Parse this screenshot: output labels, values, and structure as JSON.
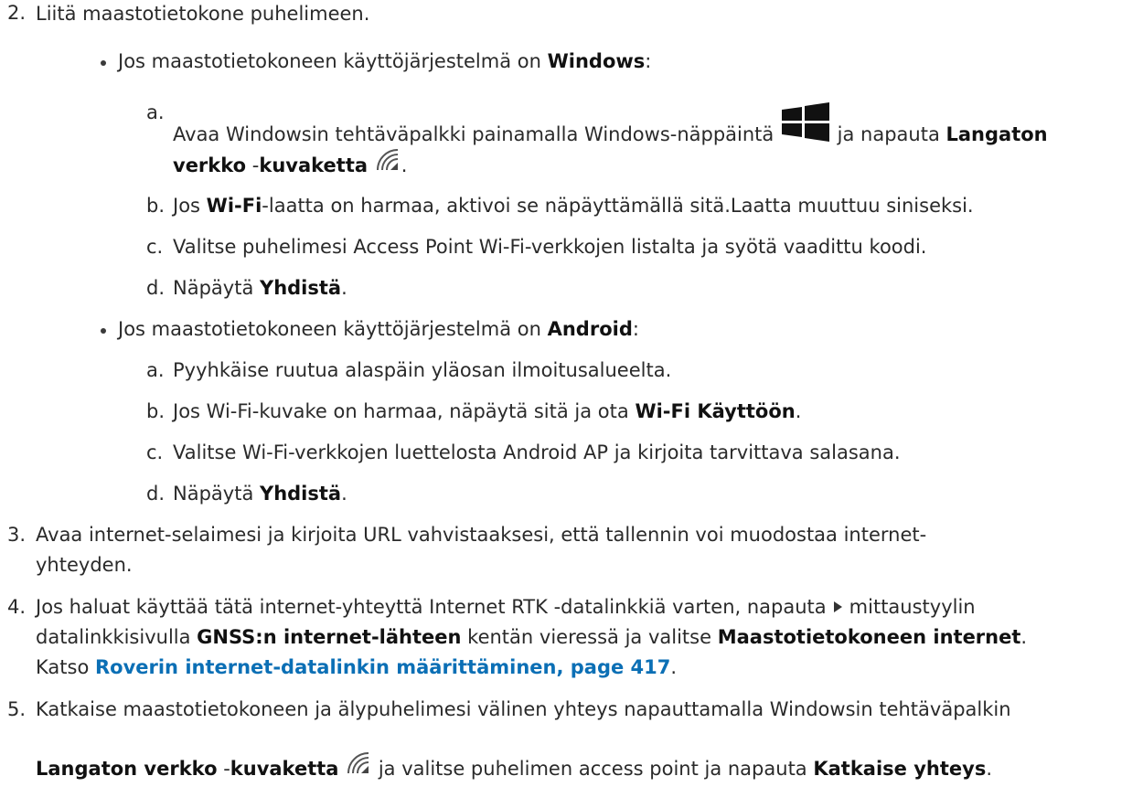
{
  "step2": {
    "num": "2.",
    "text": "Liitä maastotietokone puhelimeen.",
    "windows": {
      "intro_a": "Jos maastotietokoneen käyttöjärjestelmä on ",
      "intro_b": "Windows",
      "intro_c": ":",
      "a": {
        "num": "a.",
        "t1": "Avaa Windowsin tehtäväpalkki painamalla Windows-näppäintä ",
        "t2": " ja napauta ",
        "t3": "Langaton",
        "t4": "verkko",
        "t5": " -",
        "t6": "kuvaketta",
        "t7": "."
      },
      "b": {
        "num": "b.",
        "t1": "Jos ",
        "t2": "Wi-Fi",
        "t3": "-laatta on harmaa, aktivoi se näpäyttämällä sitä.Laatta muuttuu siniseksi."
      },
      "c": {
        "num": "c.",
        "t1": "Valitse puhelimesi Access Point Wi-Fi-verkkojen listalta ja syötä vaadittu koodi."
      },
      "d": {
        "num": "d.",
        "t1": "Näpäytä ",
        "t2": "Yhdistä",
        "t3": "."
      }
    },
    "android": {
      "intro_a": "Jos maastotietokoneen käyttöjärjestelmä on ",
      "intro_b": "Android",
      "intro_c": ":",
      "a": {
        "num": "a.",
        "t1": "Pyyhkäise ruutua alaspäin yläosan ilmoitusalueelta."
      },
      "b": {
        "num": "b.",
        "t1": "Jos Wi-Fi-kuvake on harmaa, näpäytä sitä ja ota ",
        "t2": "Wi-Fi Käyttöön",
        "t3": "."
      },
      "c": {
        "num": "c.",
        "t1": "Valitse Wi-Fi-verkkojen luettelosta Android AP ja kirjoita tarvittava salasana."
      },
      "d": {
        "num": "d.",
        "t1": "Näpäytä ",
        "t2": "Yhdistä",
        "t3": "."
      }
    }
  },
  "step3": {
    "num": "3.",
    "line1": "Avaa internet-selaimesi ja kirjoita URL vahvistaaksesi, että tallennin voi muodostaa internet-",
    "line2": "yhteyden."
  },
  "step4": {
    "num": "4.",
    "l1a": "Jos haluat käyttää tätä internet-yhteyttä Internet RTK -datalinkkiä varten, napauta",
    "l1b": "mittaustyylin",
    "l2a": "datalinkkisivulla ",
    "l2b": "GNSS:n internet-lähteen",
    "l2c": " kentän vieressä ja valitse ",
    "l2d": "Maastotietokoneen internet",
    "l2e": ".",
    "l3a": "Katso ",
    "l3link": "Roverin internet-datalinkin määrittäminen, page 417",
    "l3c": "."
  },
  "step5": {
    "num": "5.",
    "line1": "Katkaise maastotietokoneen ja älypuhelimesi välinen yhteys napauttamalla Windowsin tehtäväpalkin",
    "l2a": "Langaton verkko",
    "l2b": " -",
    "l2c": "kuvaketta",
    "l2d": " ja valitse puhelimen access point ja napauta ",
    "l2e": "Katkaise yhteys",
    "l2f": "."
  },
  "icons": {
    "windows": "windows-logo-icon",
    "wifi": "wireless-network-icon",
    "arrow": "right-triangle-arrow-icon"
  }
}
